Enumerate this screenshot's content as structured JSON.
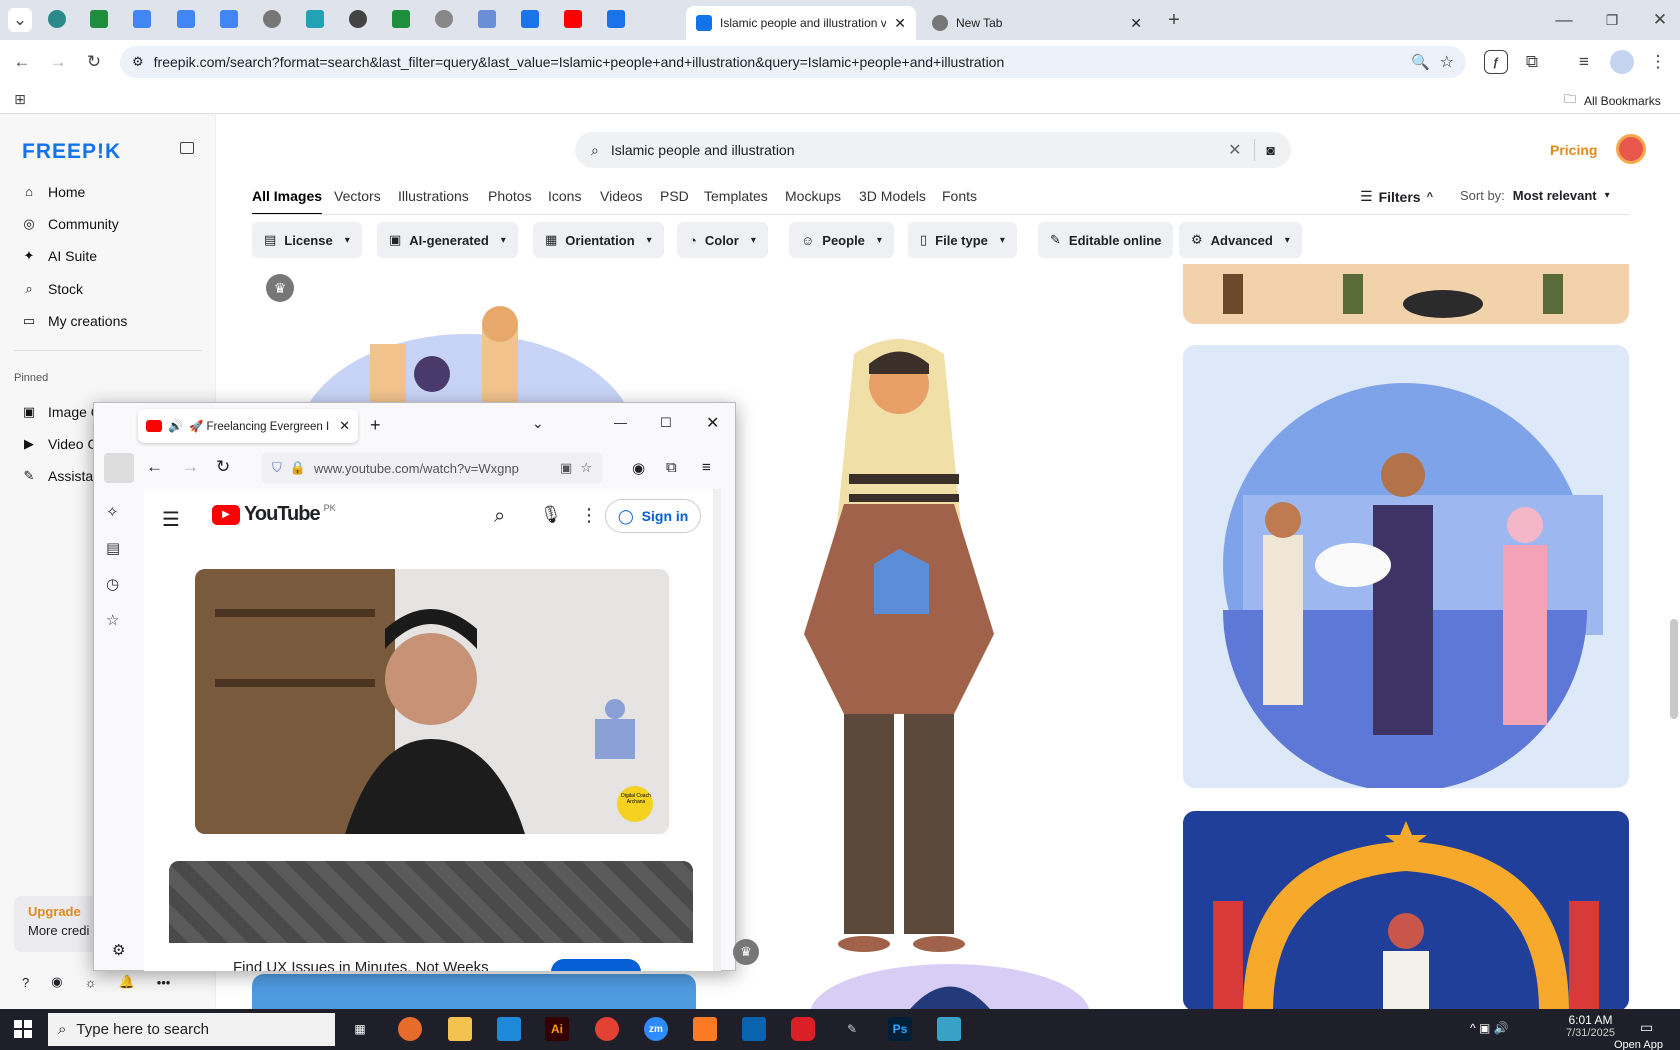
{
  "browser": {
    "active_tab_title": "Islamic people and illustration v",
    "new_tab_title": "New Tab",
    "url": "freepik.com/search?format=search&last_filter=query&last_value=Islamic+people+and+illustration&query=Islamic+people+and+illustration",
    "all_bookmarks": "All Bookmarks"
  },
  "freepik": {
    "logo": "FREEP!K",
    "nav": [
      "Home",
      "Community",
      "AI Suite",
      "Stock",
      "My creations"
    ],
    "pinned_label": "Pinned",
    "pinned": [
      "Image G",
      "Video G",
      "Assistan"
    ],
    "upgrade": "Upgrade",
    "more_credits": "More credi",
    "search_query": "Islamic people and illustration",
    "pricing": "Pricing",
    "categories": [
      "All Images",
      "Vectors",
      "Illustrations",
      "Photos",
      "Icons",
      "Videos",
      "PSD",
      "Templates",
      "Mockups",
      "3D Models",
      "Fonts"
    ],
    "filters_label": "Filters",
    "sort_label": "Sort by:",
    "sort_value": "Most relevant",
    "chips": [
      "License",
      "AI-generated",
      "Orientation",
      "Color",
      "People",
      "File type",
      "Editable online",
      "Advanced"
    ]
  },
  "popup": {
    "tab_title": "🚀 Freelancing Evergreen I",
    "url": "www.youtube.com/watch?v=Wxgnp",
    "yt_logo": "YouTube",
    "yt_region": "PK",
    "sign_in": "Sign in",
    "ad_text": "Find UX Issues in Minutes, Not Weeks",
    "badge": "Digital Coach Archana"
  },
  "taskbar": {
    "search_placeholder": "Type here to search",
    "time": "6:01 AM",
    "date": "7/31/2025",
    "open_app": "Open App"
  }
}
